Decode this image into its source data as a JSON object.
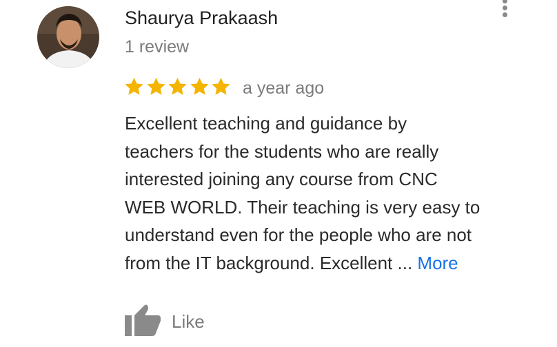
{
  "review": {
    "author_name": "Shaurya Prakaash",
    "review_count": "1 review",
    "rating": 5,
    "rating_max": 5,
    "timestamp": "a year ago",
    "text_lines": [
      "Excellent teaching and guidance by",
      "teachers for the students who are really",
      "interested joining any course from CNC",
      "WEB WORLD. Their teaching is very easy to",
      "understand even for the people who are not",
      "from the IT background. Excellent ..."
    ],
    "more_label": "More",
    "like_label": "Like"
  },
  "icons": {
    "star": "star-icon",
    "like": "thumbs-up-icon",
    "menu": "more-vert-icon"
  },
  "colors": {
    "star": "#f4b400",
    "link": "#1a73e8",
    "secondary_text": "#7b7b7b",
    "icon_gray": "#8a8a8a"
  }
}
